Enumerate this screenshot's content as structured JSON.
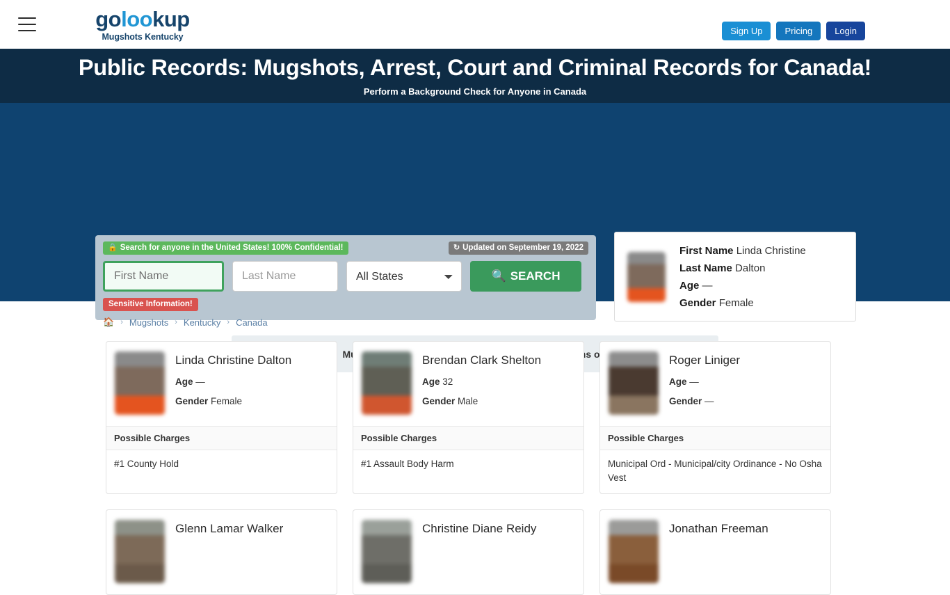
{
  "nav": {
    "menu_icon": "hamburger-icon",
    "brand_part1": "go",
    "brand_accent": "loo",
    "brand_part2": "kup",
    "brand_subtitle": "Mugshots Kentucky",
    "signup_label": "Sign Up",
    "pricing_label": "Pricing",
    "login_label": "Login",
    "colors": {
      "signup": "#1a8fd4",
      "pricing": "#1476bd",
      "login": "#17459c",
      "brand_dark": "#16446b",
      "brand_accent": "#2196d4"
    }
  },
  "hero": {
    "title": "Public Records: Mugshots, Arrest, Court and Criminal Records for Canada!",
    "subtitle": "Perform a Background Check for Anyone in Canada",
    "bg_color": "#0e2c45"
  },
  "search": {
    "section_bg": "#0f4370",
    "panel_bg": "#b8c6d1",
    "confidential_badge": "Search for anyone in the United States! 100% Confidential!",
    "confidential_icon": "lock-icon",
    "confidential_color": "#5cb85c",
    "updated_badge": "Updated on September 19, 2022",
    "updated_icon": "refresh-icon",
    "updated_color": "#7a7a7a",
    "first_name_placeholder": "First Name",
    "first_name_value": "",
    "last_name_placeholder": "Last Name",
    "last_name_value": "",
    "state_selected": "All States",
    "state_options": [
      "All States"
    ],
    "search_button": "SEARCH",
    "search_icon": "search-icon",
    "search_color": "#3a9a5c",
    "sensitive_badge": "Sensitive Information!",
    "sensitive_color": "#d9534f"
  },
  "info_card": {
    "avatar": "mugshot-thumbnail",
    "first_name_label": "First Name",
    "first_name": "Linda Christine",
    "last_name_label": "Last Name",
    "last_name": "Dalton",
    "age_label": "Age",
    "age": "—",
    "gender_label": "Gender",
    "gender": "Female"
  },
  "warning": {
    "icon": "warning-triangle-icon",
    "text": "Mugshots and Criminal Records. Please Check Terms of Use!",
    "icon_color": "#e8491d",
    "bg_color": "#e9eef1"
  },
  "breadcrumb": {
    "home_icon": "home-icon",
    "items": [
      "Mugshots",
      "Kentucky",
      "Canada"
    ],
    "separator": "›"
  },
  "results": {
    "charges_header": "Possible Charges",
    "age_label": "Age",
    "gender_label": "Gender",
    "cards": [
      {
        "name": "Linda Christine Dalton",
        "age": "—",
        "gender": "Female",
        "charge": "#1 County Hold",
        "mug_top": "#8a8a8a",
        "mug_mid": "#7e6a5c",
        "mug_bottom": "#e4541f"
      },
      {
        "name": "Brendan Clark Shelton",
        "age": "32",
        "gender": "Male",
        "charge": "#1 Assault Body Harm",
        "mug_top": "#6f7d76",
        "mug_mid": "#5f5f55",
        "mug_bottom": "#d0562f"
      },
      {
        "name": "Roger Liniger",
        "age": "—",
        "gender": "—",
        "charge": "Municipal Ord - Municipal/city Ordinance - No Osha Vest",
        "mug_top": "#8d8d8d",
        "mug_mid": "#4a3a30",
        "mug_bottom": "#8a7560"
      },
      {
        "name": "Glenn Lamar Walker",
        "age": "",
        "gender": "",
        "charge": "",
        "mug_top": "#8d9188",
        "mug_mid": "#7d6a58",
        "mug_bottom": "#6b5a4a"
      },
      {
        "name": "Christine Diane Reidy",
        "age": "",
        "gender": "",
        "charge": "",
        "mug_top": "#9aa09a",
        "mug_mid": "#6e6e68",
        "mug_bottom": "#5e5e58"
      },
      {
        "name": "Jonathan Freeman",
        "age": "",
        "gender": "",
        "charge": "",
        "mug_top": "#9b9b99",
        "mug_mid": "#8a5f3c",
        "mug_bottom": "#7a4a28"
      }
    ]
  }
}
